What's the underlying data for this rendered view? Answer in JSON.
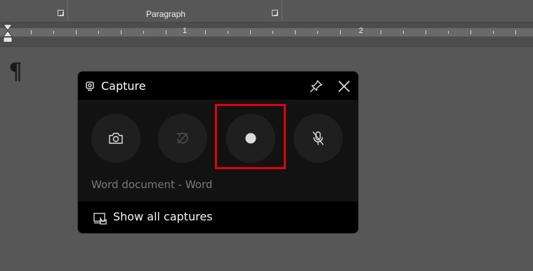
{
  "ribbon": {
    "group_label": "Paragraph"
  },
  "ruler": {
    "numbers": [
      "1",
      "2"
    ]
  },
  "document": {
    "paragraph_mark": "¶"
  },
  "capture_widget": {
    "title": "Capture",
    "buttons": [
      {
        "name": "screenshot",
        "icon": "camera-icon",
        "enabled": true
      },
      {
        "name": "record-last-30-seconds",
        "icon": "replay-icon",
        "enabled": false
      },
      {
        "name": "start-recording",
        "icon": "record-icon",
        "enabled": true,
        "highlighted": true
      },
      {
        "name": "microphone",
        "icon": "mic-off-icon",
        "enabled": true
      }
    ],
    "app_name": "Word document - Word",
    "footer_label": "Show all captures",
    "highlight_color": "#e3000f"
  }
}
